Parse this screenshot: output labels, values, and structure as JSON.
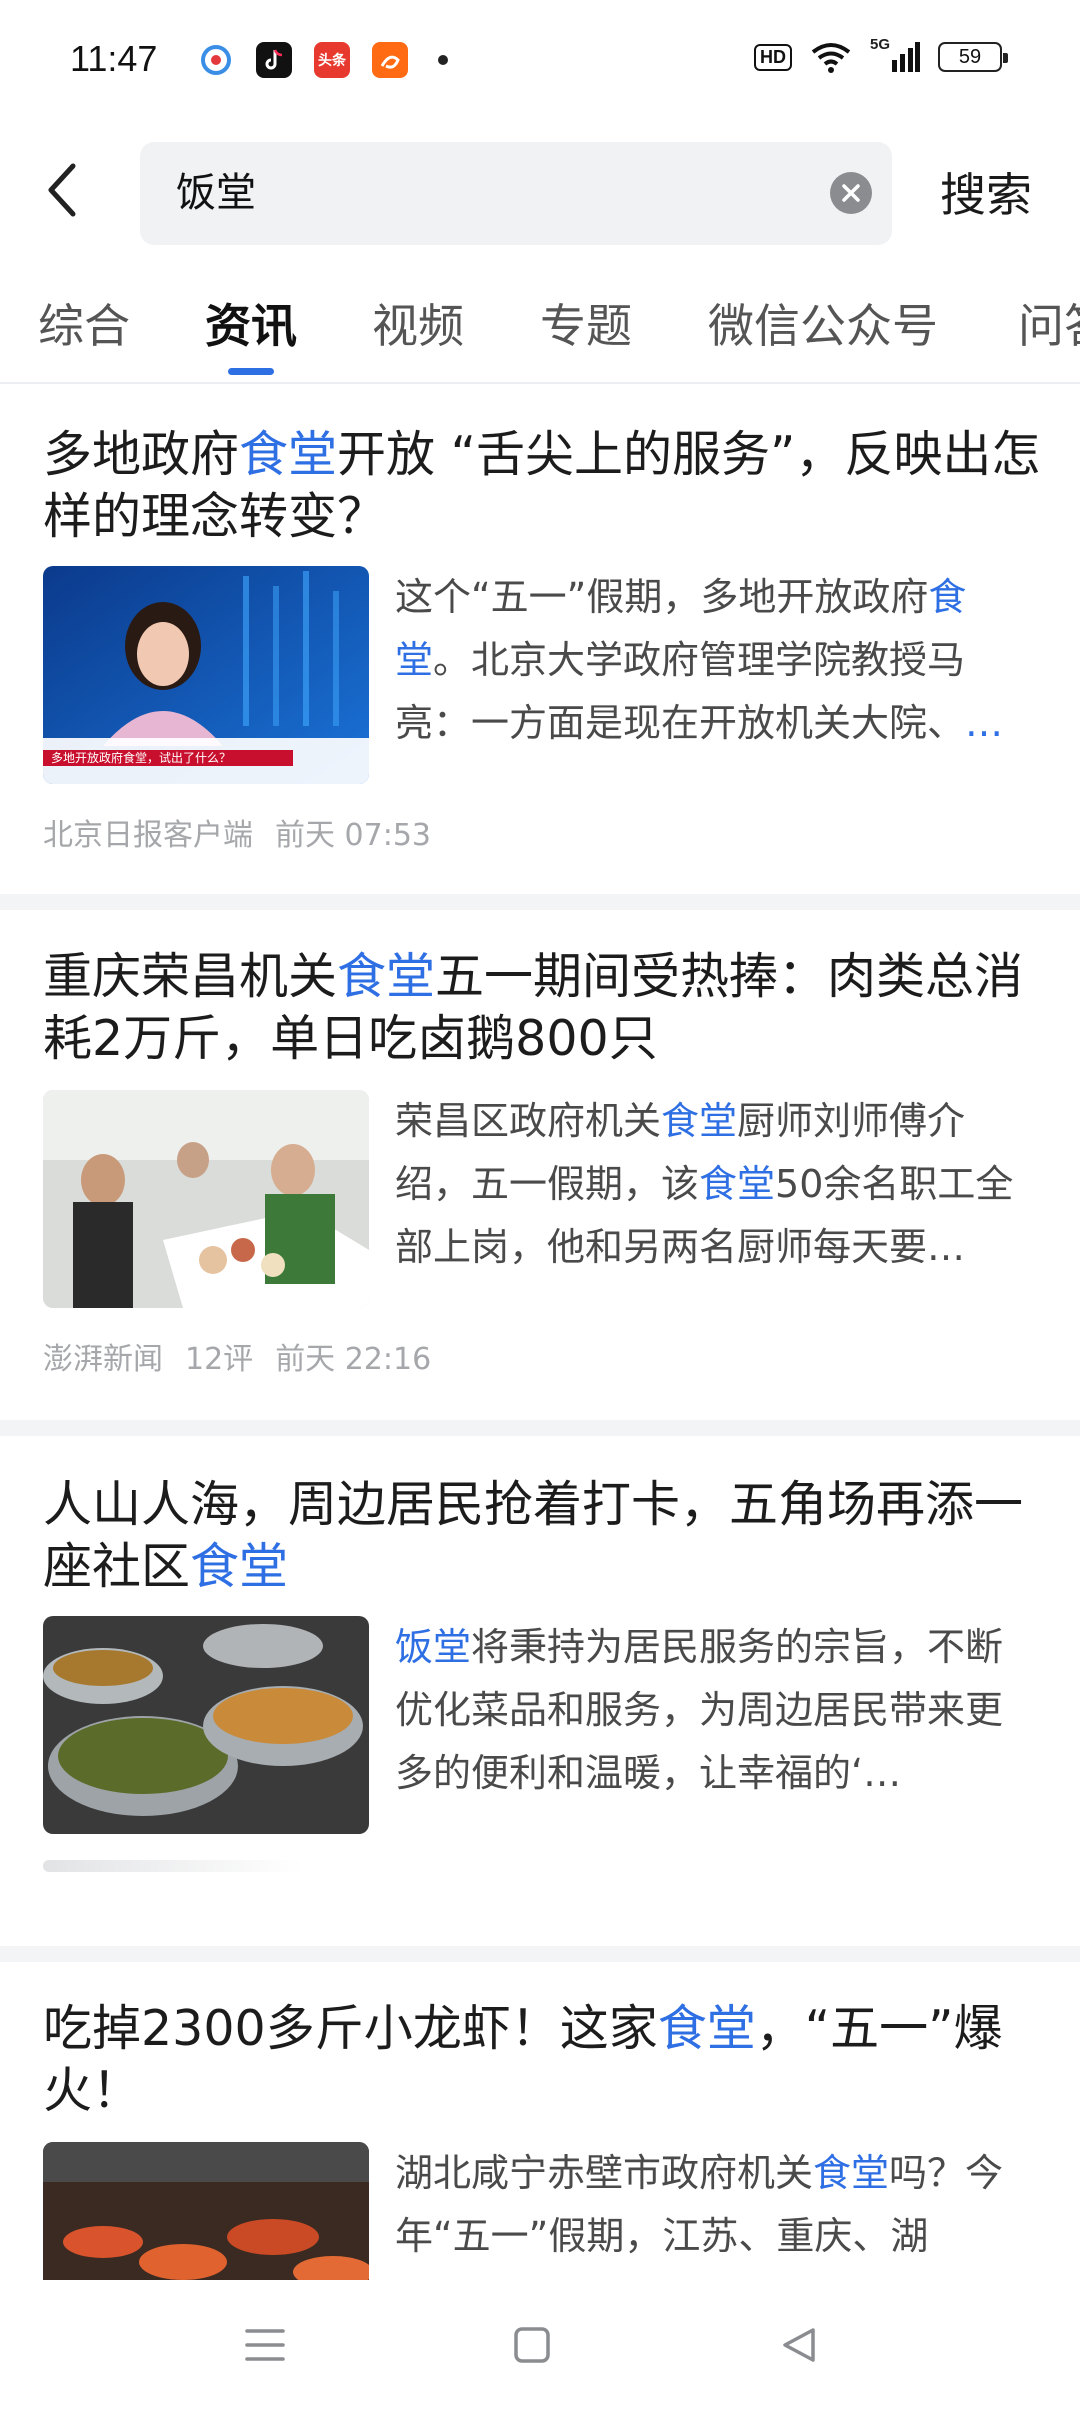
{
  "status_bar": {
    "time": "11:47",
    "network": "5G",
    "hd": "HD",
    "battery": "59",
    "app_icons": [
      "weibo-icon",
      "douyin-icon",
      "toutiao-icon",
      "taobao-icon"
    ],
    "app_icon_labels": [
      "",
      "抖音",
      "头条",
      "淘宝"
    ]
  },
  "search": {
    "query": "饭堂",
    "submit_label": "搜索"
  },
  "tabs": [
    {
      "label": "综合"
    },
    {
      "label": "资讯"
    },
    {
      "label": "视频"
    },
    {
      "label": "专题"
    },
    {
      "label": "微信公众号"
    },
    {
      "label": "问答"
    }
  ],
  "active_tab": 1,
  "articles": [
    {
      "title_parts": [
        "多地政府",
        "食堂",
        "开放 “舌尖上的服务”，反映出怎样的理念转变？"
      ],
      "snippet_parts": [
        "这个“五一”假期，多地开放政府",
        "食堂",
        "。北京大学政府管理学院教授马亮：一方面是现在开放机关大院、",
        "…"
      ],
      "thumb_caption": "多地开放政府食堂，试出了什么？",
      "source": "北京日报客户端",
      "comments": "",
      "time": "前天 07:53"
    },
    {
      "title_parts": [
        "重庆荣昌机关",
        "食堂",
        "五一期间受热捧：肉类总消耗2万斤，单日吃卤鹅800只"
      ],
      "snippet_parts": [
        "荣昌区政府机关",
        "食堂",
        "厨师刘师傅介绍，五一假期，该",
        "食堂",
        "50余名职工全部上岗，他和另两名厨师每天要…"
      ],
      "source": "澎湃新闻",
      "comments": "12评",
      "time": "前天 22:16"
    },
    {
      "title_parts": [
        "人山人海，周边居民抢着打卡，五角场再添一座社区",
        "食堂",
        ""
      ],
      "snippet_parts": [
        "饭堂",
        "将秉持为居民服务的宗旨，不断优化菜品和服务，为周边居民带来更多的便利和温暖，让幸福的‘…"
      ],
      "source": "",
      "comments": "",
      "time": ""
    },
    {
      "title_parts": [
        "吃掉2300多斤小龙虾！这家",
        "食堂",
        "，“五一”爆火！"
      ],
      "snippet_parts": [
        "湖北咸宁赤壁市政府机关",
        "食堂",
        "吗？今年“五一”假期，江苏、重庆、湖"
      ]
    }
  ],
  "colors": {
    "accent": "#2f6fe4",
    "meta_text": "#a5a7ab",
    "search_bg": "#f1f2f4"
  }
}
